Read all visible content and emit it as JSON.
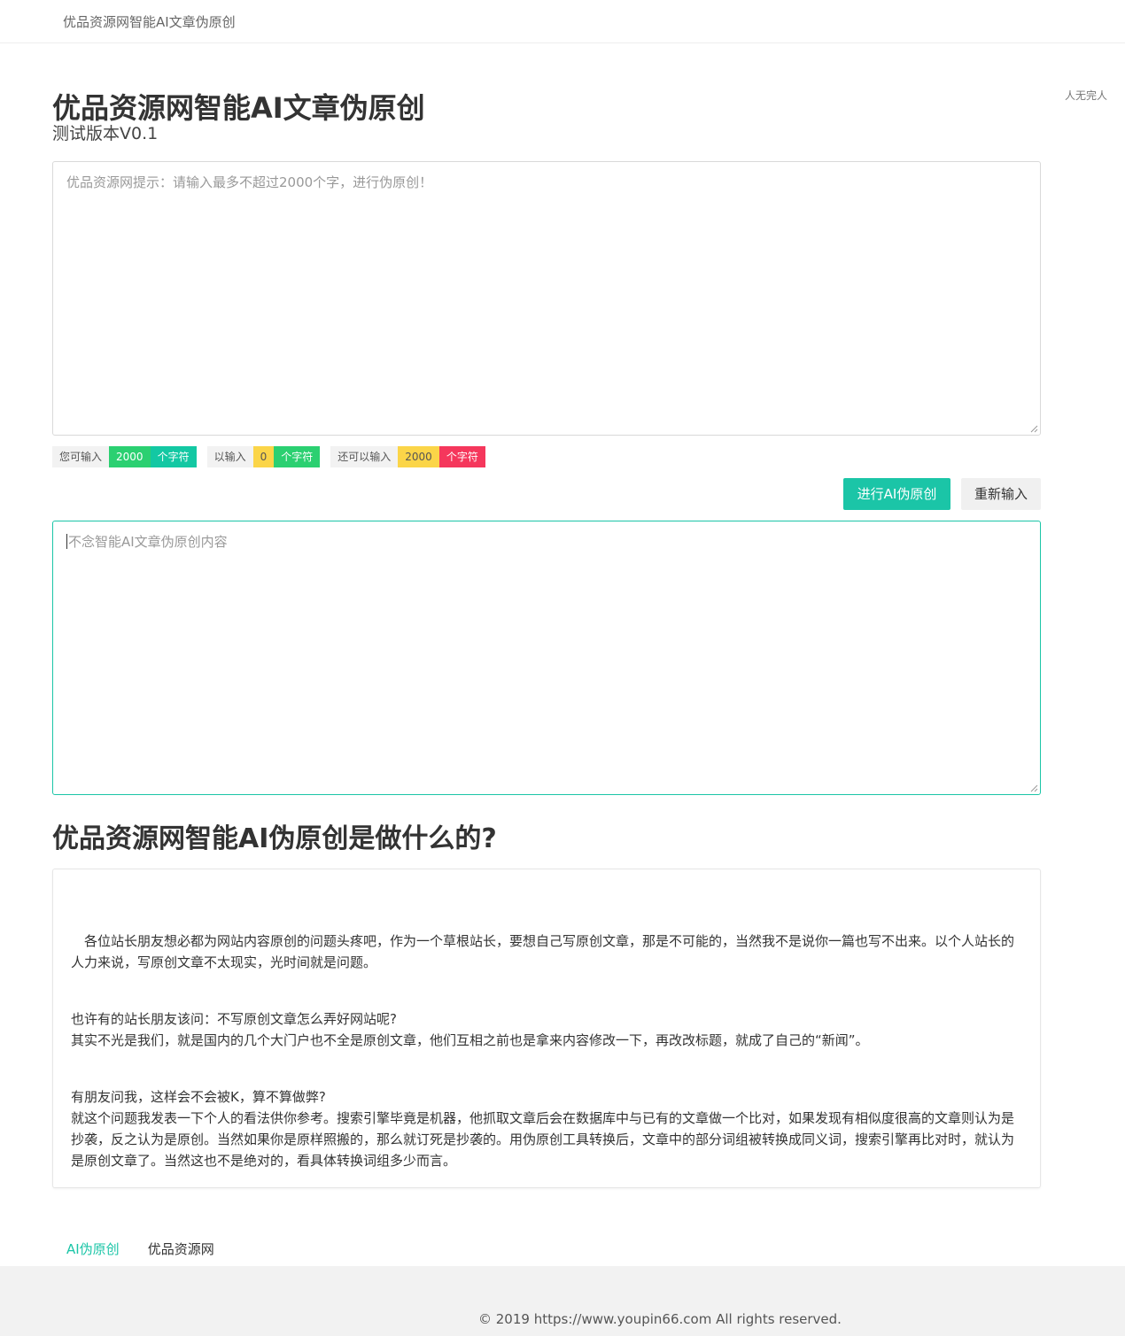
{
  "topbar": {
    "brand": "优品资源网智能AI文章伪原创"
  },
  "side_note": "人无完人",
  "header": {
    "title": "优品资源网智能AI文章伪原创",
    "subtitle": "测试版本V0.1"
  },
  "input_area": {
    "placeholder": "优品资源网提示：请输入最多不超过2000个字，进行伪原创！"
  },
  "counters": [
    {
      "label": "您可输入",
      "value": "2000",
      "unit": "个字符"
    },
    {
      "label": "以输入",
      "value": "0",
      "unit": "个字符"
    },
    {
      "label": "还可以输入",
      "value": "2000",
      "unit": "个字符"
    }
  ],
  "buttons": {
    "rewrite": "进行AI伪原创",
    "reset": "重新输入"
  },
  "output_area": {
    "placeholder": "不念智能AI文章伪原创内容"
  },
  "about": {
    "title": "优品资源网智能AI伪原创是做什么的?",
    "paragraphs": [
      "各位站长朋友想必都为网站内容原创的问题头疼吧，作为一个草根站长，要想自己写原创文章，那是不可能的，当然我不是说你一篇也写不出来。以个人站长的人力来说，写原创文章不太现实，光时间就是问题。",
      "也许有的站长朋友该问：不写原创文章怎么弄好网站呢?",
      "其实不光是我们，就是国内的几个大门户也不全是原创文章，他们互相之前也是拿来内容修改一下，再改改标题，就成了自己的“新闻”。",
      "有朋友问我，这样会不会被K，算不算做弊?",
      "就这个问题我发表一下个人的看法供你参考。搜索引擎毕竟是机器，他抓取文章后会在数据库中与已有的文章做一个比对，如果发现有相似度很高的文章则认为是抄袭，反之认为是原创。当然如果你是原样照搬的，那么就订死是抄袭的。用伪原创工具转换后，文章中的部分词组被转换成同义词，搜索引擎再比对时，就认为是原创文章了。当然这也不是绝对的，看具体转换词组多少而言。"
    ]
  },
  "footer_links": [
    "AI伪原创",
    "优品资源网"
  ],
  "footer": {
    "copyright": "© 2019 https://www.youpin66.com All rights reserved."
  },
  "colors": {
    "accent": "#1bc5a7",
    "green": "#2bd071",
    "yellow": "#fbd548",
    "red": "#f5375c"
  }
}
